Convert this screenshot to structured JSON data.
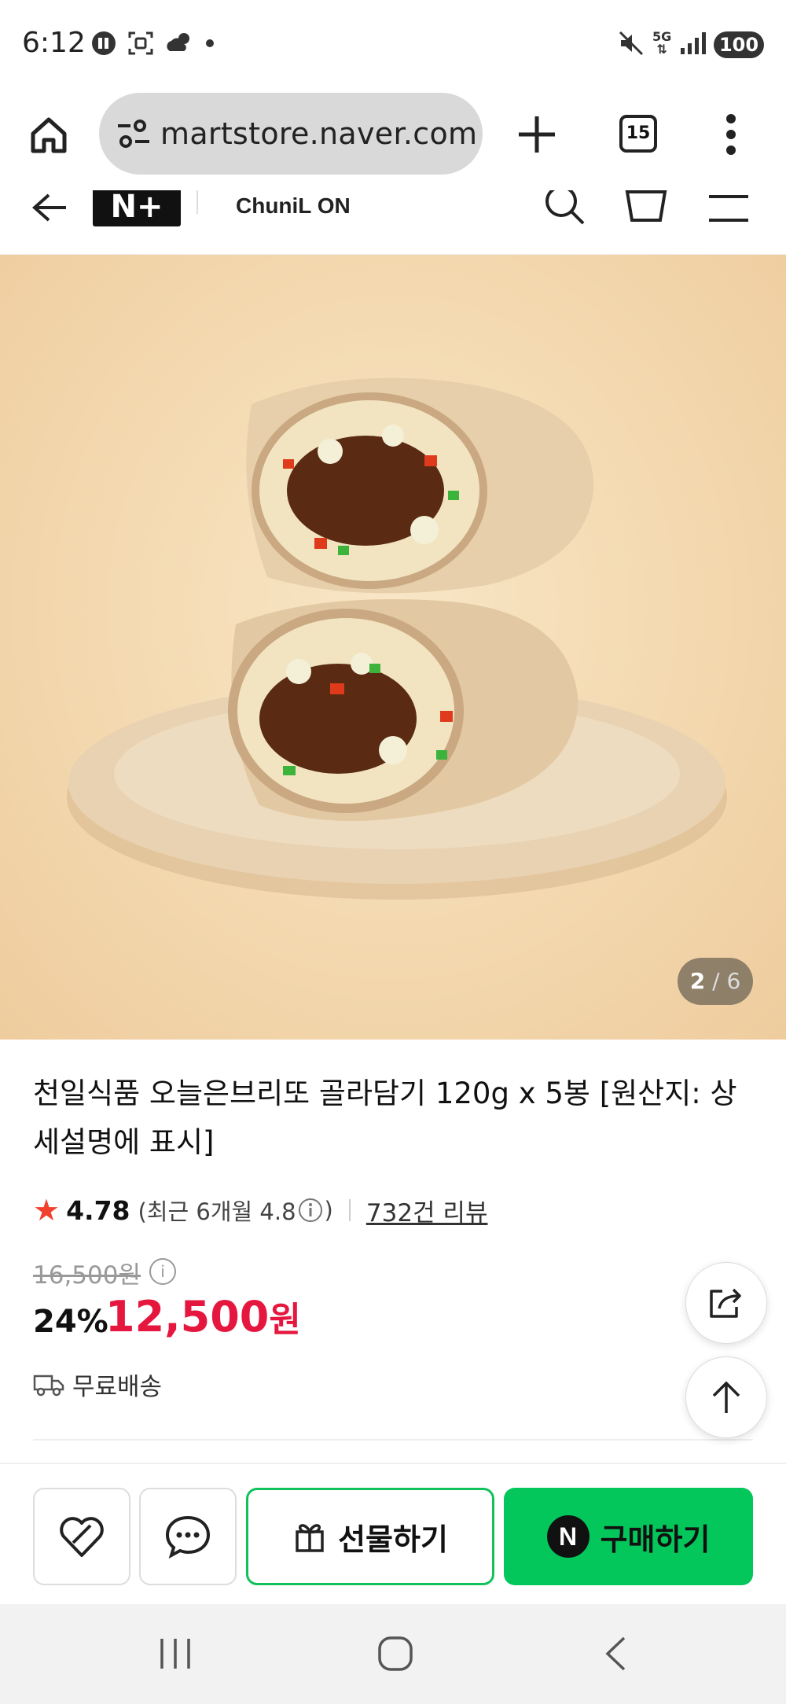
{
  "status_bar": {
    "time": "6:12",
    "battery": "100",
    "network": "5G"
  },
  "browser": {
    "url": "martstore.naver.com",
    "tab_count": "15"
  },
  "site_header": {
    "logo": "N+",
    "brand": "ChuniL ON"
  },
  "gallery": {
    "current": "2",
    "separator": "/",
    "total": "6"
  },
  "product": {
    "title": "천일식품 오늘은브리또 골라담기 120g x 5봉 [원산지: 상세설명에 표시]",
    "rating": "4.78",
    "rating_recent": "(최근 6개월 4.8",
    "rating_recent_close": ")",
    "review_link": "732건 리뷰",
    "original_price": "16,500원",
    "discount": "24%",
    "price_number": "12,500",
    "price_unit": "원",
    "delivery": "무료배송"
  },
  "actions": {
    "gift_label": "선물하기",
    "buy_label": "구매하기",
    "npay_badge": "N"
  },
  "colors": {
    "accent_green": "#03c75a",
    "price_red": "#e5173f",
    "star_red": "#f0412f"
  }
}
